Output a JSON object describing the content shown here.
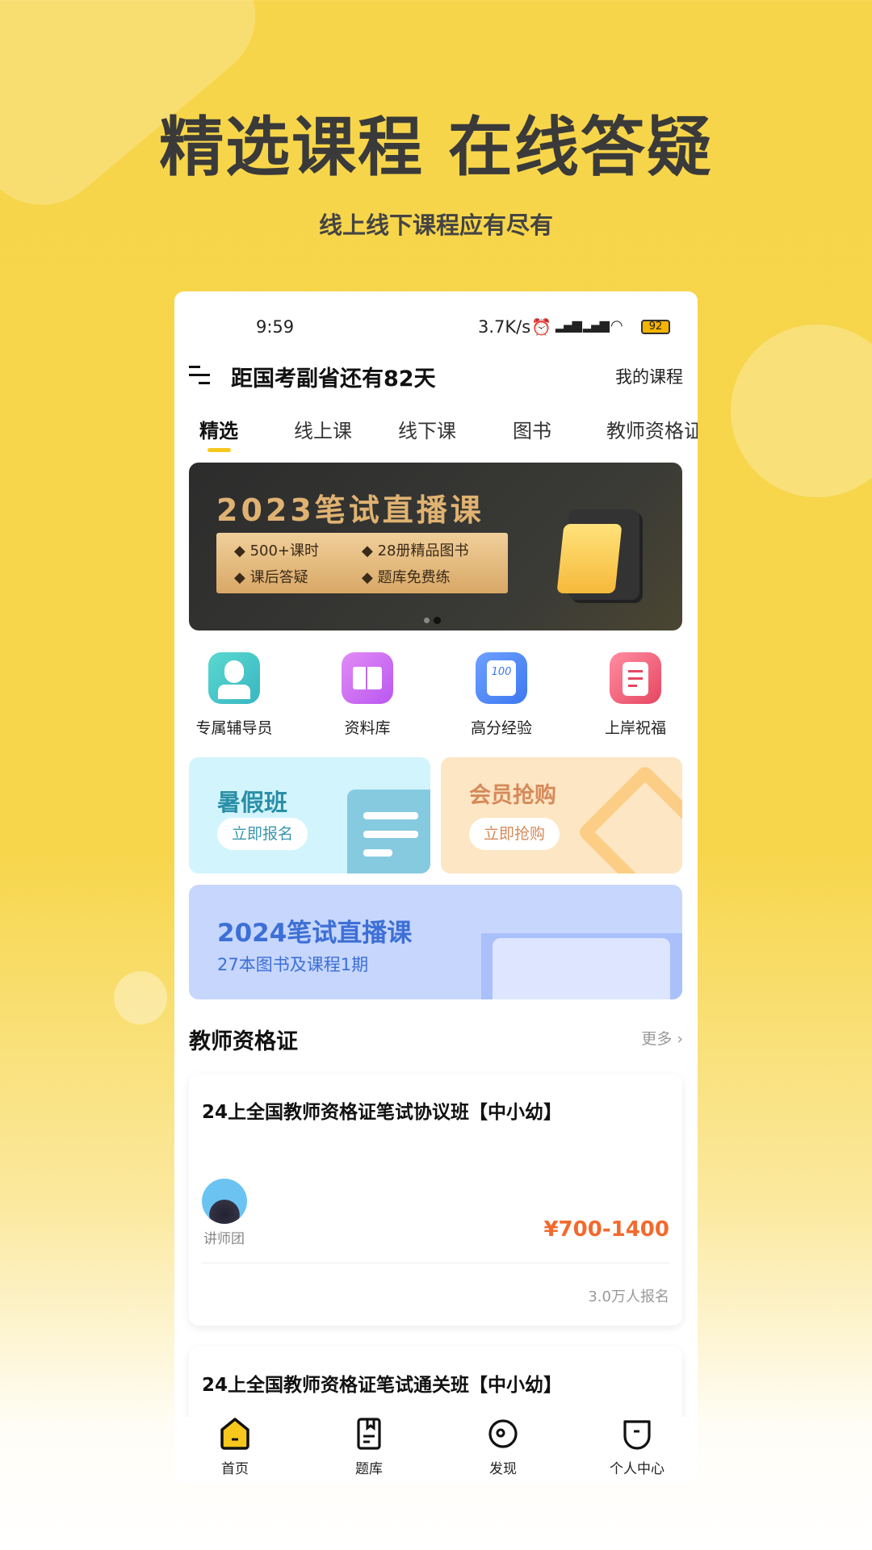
{
  "hero": {
    "title": "精选课程 在线答疑",
    "subtitle": "线上线下课程应有尽有"
  },
  "status": {
    "time": "9:59",
    "speed": "3.7K/s",
    "battery": "92"
  },
  "header": {
    "countdown": "距国考副省还有82天",
    "my_courses": "我的课程"
  },
  "tabs": [
    {
      "label": "精选",
      "active": true
    },
    {
      "label": "线上课"
    },
    {
      "label": "线下课"
    },
    {
      "label": "图书"
    },
    {
      "label": "教师资格证"
    }
  ],
  "banner": {
    "title": "2023笔试直播课",
    "features": [
      "500+课时",
      "28册精品图书",
      "课后答疑",
      "题库免费练"
    ],
    "slide": 2,
    "slides": 2
  },
  "quick": [
    {
      "label": "专属辅导员",
      "icon": "counselor-icon"
    },
    {
      "label": "资料库",
      "icon": "book-icon"
    },
    {
      "label": "高分经验",
      "icon": "score-100-icon"
    },
    {
      "label": "上岸祝福",
      "icon": "clipboard-icon"
    }
  ],
  "promo": {
    "left": {
      "title": "暑假班",
      "button": "立即报名"
    },
    "right": {
      "title": "会员抢购",
      "button": "立即抢购"
    },
    "wide": {
      "title": "2024笔试直播课",
      "subtitle": "27本图书及课程1期"
    }
  },
  "section": {
    "title": "教师资格证",
    "more": "更多"
  },
  "courses": [
    {
      "title": "24上全国教师资格证笔试协议班【中小幼】",
      "teacher": "讲师团",
      "price": "¥700-1400",
      "enrolled": "3.0万人报名"
    },
    {
      "title": "24上全国教师资格证笔试通关班【中小幼】"
    }
  ],
  "nav": [
    {
      "label": "首页",
      "active": true
    },
    {
      "label": "题库"
    },
    {
      "label": "发现"
    },
    {
      "label": "个人中心"
    }
  ],
  "colors": {
    "accent": "#F7C71E",
    "price": "#F26A2E",
    "background": "#F7D54A"
  }
}
